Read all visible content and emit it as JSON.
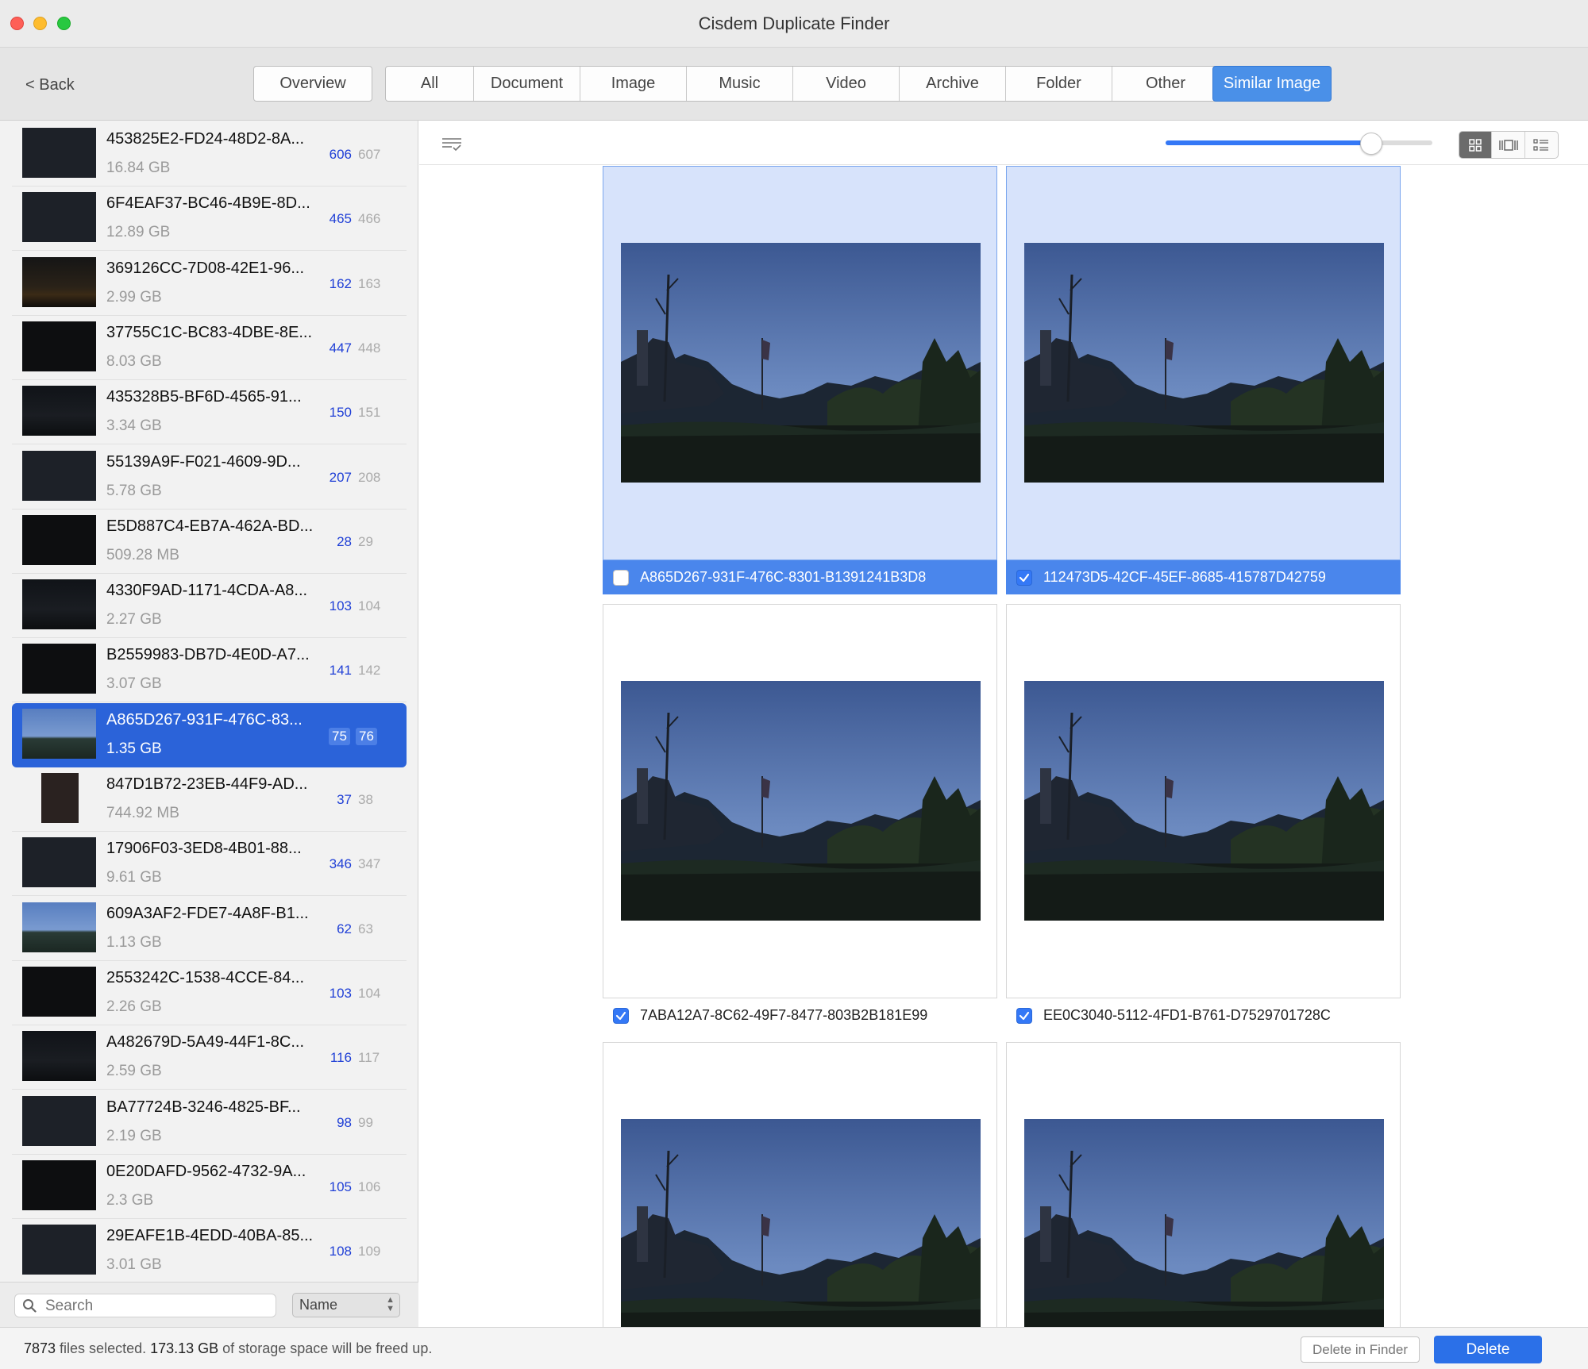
{
  "window": {
    "title": "Cisdem Duplicate Finder"
  },
  "toolbar": {
    "back_label": "< Back",
    "overview_label": "Overview",
    "tabs": [
      "All",
      "Document",
      "Image",
      "Music",
      "Video",
      "Archive",
      "Folder",
      "Other"
    ],
    "similar_image_label": "Similar Image",
    "active_tab": "Similar Image"
  },
  "sidebar": {
    "items": [
      {
        "name": "453825E2-FD24-48D2-8A...",
        "size": "16.84 GB",
        "count_a": "606",
        "count_b": "607",
        "thumb": "night"
      },
      {
        "name": "6F4EAF37-BC46-4B9E-8D...",
        "size": "12.89 GB",
        "count_a": "465",
        "count_b": "466",
        "thumb": "night"
      },
      {
        "name": "369126CC-7D08-42E1-96...",
        "size": "2.99 GB",
        "count_a": "162",
        "count_b": "163",
        "thumb": "orange"
      },
      {
        "name": "37755C1C-BC83-4DBE-8E...",
        "size": "8.03 GB",
        "count_a": "447",
        "count_b": "448",
        "thumb": "dark"
      },
      {
        "name": "435328B5-BF6D-4565-91...",
        "size": "3.34 GB",
        "count_a": "150",
        "count_b": "151",
        "thumb": "night2"
      },
      {
        "name": "55139A9F-F021-4609-9D...",
        "size": "5.78 GB",
        "count_a": "207",
        "count_b": "208",
        "thumb": "night"
      },
      {
        "name": "E5D887C4-EB7A-462A-BD...",
        "size": "509.28 MB",
        "count_a": "28",
        "count_b": "29",
        "thumb": "dark"
      },
      {
        "name": "4330F9AD-1171-4CDA-A8...",
        "size": "2.27 GB",
        "count_a": "103",
        "count_b": "104",
        "thumb": "night2"
      },
      {
        "name": "B2559983-DB7D-4E0D-A7...",
        "size": "3.07 GB",
        "count_a": "141",
        "count_b": "142",
        "thumb": "dark"
      },
      {
        "name": "A865D267-931F-476C-83...",
        "size": "1.35 GB",
        "count_a": "75",
        "count_b": "76",
        "thumb": "day",
        "selected": true
      },
      {
        "name": "847D1B72-23EB-44F9-AD...",
        "size": "744.92 MB",
        "count_a": "37",
        "count_b": "38",
        "thumb": "portrait"
      },
      {
        "name": "17906F03-3ED8-4B01-88...",
        "size": "9.61 GB",
        "count_a": "346",
        "count_b": "347",
        "thumb": "night"
      },
      {
        "name": "609A3AF2-FDE7-4A8F-B1...",
        "size": "1.13 GB",
        "count_a": "62",
        "count_b": "63",
        "thumb": "day"
      },
      {
        "name": "2553242C-1538-4CCE-84...",
        "size": "2.26 GB",
        "count_a": "103",
        "count_b": "104",
        "thumb": "dark"
      },
      {
        "name": "A482679D-5A49-44F1-8C...",
        "size": "2.59 GB",
        "count_a": "116",
        "count_b": "117",
        "thumb": "night2"
      },
      {
        "name": "BA77724B-3246-4825-BF...",
        "size": "2.19 GB",
        "count_a": "98",
        "count_b": "99",
        "thumb": "night"
      },
      {
        "name": "0E20DAFD-9562-4732-9A...",
        "size": "2.3 GB",
        "count_a": "105",
        "count_b": "106",
        "thumb": "dark"
      },
      {
        "name": "29EAFE1B-4EDD-40BA-85...",
        "size": "3.01 GB",
        "count_a": "108",
        "count_b": "109",
        "thumb": "night"
      }
    ],
    "search_placeholder": "Search",
    "sort_value": "Name"
  },
  "main": {
    "thumbnail_size_fraction": 0.77,
    "view_mode": "grid",
    "images": [
      {
        "name": "A865D267-931F-476C-8301-B1391241B3D8",
        "checked": false,
        "highlighted": true
      },
      {
        "name": "112473D5-42CF-45EF-8685-415787D42759",
        "checked": true,
        "highlighted": true
      },
      {
        "name": "7ABA12A7-8C62-49F7-8477-803B2B181E99",
        "checked": true,
        "highlighted": false
      },
      {
        "name": "EE0C3040-5112-4FD1-B761-D7529701728C",
        "checked": true,
        "highlighted": false
      },
      {
        "name": "",
        "checked": false,
        "highlighted": false
      },
      {
        "name": "",
        "checked": false,
        "highlighted": false
      }
    ]
  },
  "status": {
    "files_selected": "7873",
    "files_label": " files selected. ",
    "space": "173.13 GB",
    "space_label": " of storage space will be freed up.",
    "delete_in_finder_label": "Delete in Finder",
    "delete_label": "Delete"
  },
  "colors": {
    "accent": "#3478f6",
    "selection": "#2b63d9",
    "count_blue": "#1f3fd6"
  }
}
